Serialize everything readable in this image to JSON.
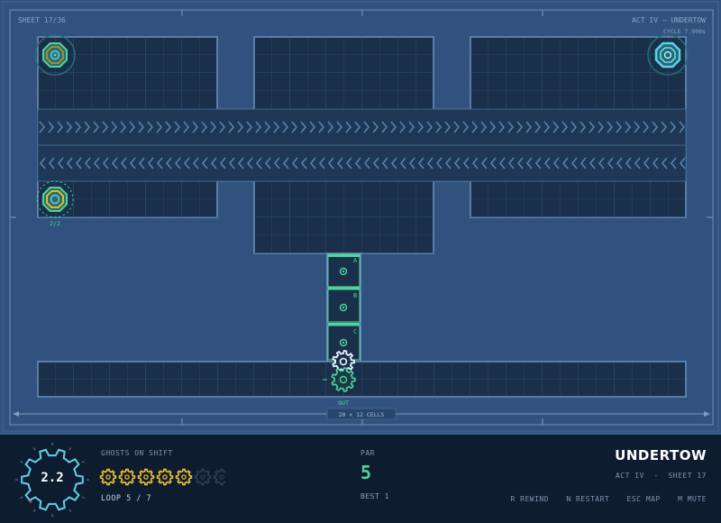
{
  "header": {
    "sheet": "SHEET 17/36",
    "act": "ACT IV — UNDERTOW",
    "cycle": "CYCLE 7.000s"
  },
  "board": {
    "dimensions_label": "20 × 12 CELLS",
    "spawn_counter": "2/2",
    "out_label": "OUT",
    "gates": [
      "A",
      "B",
      "C"
    ]
  },
  "hud": {
    "timer_value": "2.2",
    "ghosts_label": "GHOSTS ON SHIFT",
    "ghosts_total": 7,
    "ghosts_active": 5,
    "loop_label": "LOOP 5 / 7",
    "par_label": "PAR",
    "par_value": "5",
    "best_label": "BEST 1",
    "title": "UNDERTOW",
    "subtitle": "ACT IV  ·  SHEET 17",
    "keys": [
      "R REWIND",
      "N RESTART",
      "ESC MAP",
      "M MUTE"
    ]
  },
  "colors": {
    "background": "#31527e",
    "floor": "#1a2f4a",
    "accent_green": "#4fd49a",
    "accent_cyan": "#5fd0e8",
    "gold": "#f2c230",
    "hud_bg": "#0e1c30"
  }
}
